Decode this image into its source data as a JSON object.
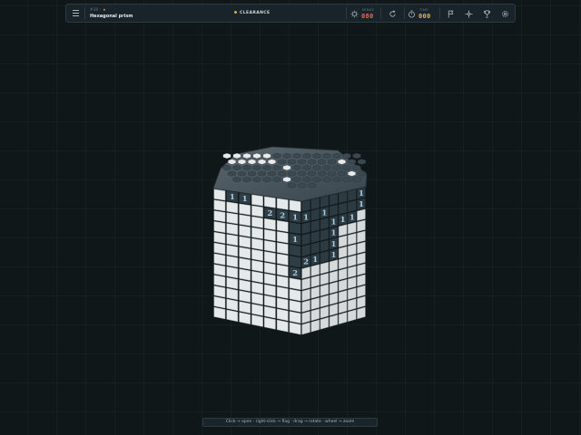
{
  "header": {
    "breadcrumb": "#30",
    "level_title": "Hexagonal prism",
    "mode_label": "CLEARANCE",
    "menu_icon": "hamburger-menu-icon",
    "accent_star_color": "#e0934a"
  },
  "stats": {
    "mines_label": "MINES",
    "mines_value": "080",
    "mines_color": "#e26a5a",
    "time_label": "TIME",
    "time_value": "000",
    "time_color": "#e3b54a"
  },
  "toolbar": {
    "buttons": [
      "restart-icon",
      "flag-icon",
      "crosshair-icon",
      "trophy-icon",
      "settings-icon"
    ]
  },
  "hint": "Click → open · right-click → flag · drag → rotate · wheel → zoom",
  "board": {
    "shape": "hexagonal prism",
    "grid_rows": 12,
    "face_left_columns": 7,
    "face_right_columns": 7,
    "cell_colors": {
      "closed": "#e6e9ea",
      "opened": "#2f3d45",
      "number": "#a9cde2"
    },
    "opened_cells": [
      {
        "face": "left",
        "row": 0,
        "col": 1,
        "number": "1"
      },
      {
        "face": "left",
        "row": 0,
        "col": 2,
        "number": "1"
      },
      {
        "face": "left",
        "row": 1,
        "col": 4,
        "number": "2"
      },
      {
        "face": "left",
        "row": 1,
        "col": 5,
        "number": "2"
      },
      {
        "face": "left",
        "row": 1,
        "col": 6,
        "number": "1"
      },
      {
        "face": "left",
        "row": 2,
        "col": 6,
        "number": ""
      },
      {
        "face": "left",
        "row": 3,
        "col": 6,
        "number": "1"
      },
      {
        "face": "left",
        "row": 4,
        "col": 6,
        "number": ""
      },
      {
        "face": "left",
        "row": 5,
        "col": 6,
        "number": ""
      },
      {
        "face": "left",
        "row": 6,
        "col": 6,
        "number": "2"
      },
      {
        "face": "right",
        "row": 0,
        "col": 0,
        "number": ""
      },
      {
        "face": "right",
        "row": 0,
        "col": 1,
        "number": ""
      },
      {
        "face": "right",
        "row": 0,
        "col": 2,
        "number": ""
      },
      {
        "face": "right",
        "row": 0,
        "col": 3,
        "number": ""
      },
      {
        "face": "right",
        "row": 0,
        "col": 4,
        "number": ""
      },
      {
        "face": "right",
        "row": 0,
        "col": 5,
        "number": ""
      },
      {
        "face": "right",
        "row": 0,
        "col": 6,
        "number": "1"
      },
      {
        "face": "right",
        "row": 1,
        "col": 0,
        "number": "1"
      },
      {
        "face": "right",
        "row": 1,
        "col": 1,
        "number": ""
      },
      {
        "face": "right",
        "row": 1,
        "col": 2,
        "number": "1"
      },
      {
        "face": "right",
        "row": 1,
        "col": 3,
        "number": ""
      },
      {
        "face": "right",
        "row": 1,
        "col": 4,
        "number": ""
      },
      {
        "face": "right",
        "row": 1,
        "col": 5,
        "number": ""
      },
      {
        "face": "right",
        "row": 1,
        "col": 6,
        "number": "1"
      },
      {
        "face": "right",
        "row": 2,
        "col": 0,
        "number": ""
      },
      {
        "face": "right",
        "row": 2,
        "col": 1,
        "number": ""
      },
      {
        "face": "right",
        "row": 2,
        "col": 2,
        "number": ""
      },
      {
        "face": "right",
        "row": 2,
        "col": 3,
        "number": "1"
      },
      {
        "face": "right",
        "row": 2,
        "col": 4,
        "number": "1"
      },
      {
        "face": "right",
        "row": 2,
        "col": 5,
        "number": "1"
      },
      {
        "face": "right",
        "row": 3,
        "col": 0,
        "number": ""
      },
      {
        "face": "right",
        "row": 3,
        "col": 1,
        "number": ""
      },
      {
        "face": "right",
        "row": 3,
        "col": 2,
        "number": ""
      },
      {
        "face": "right",
        "row": 3,
        "col": 3,
        "number": "1"
      },
      {
        "face": "right",
        "row": 4,
        "col": 0,
        "number": ""
      },
      {
        "face": "right",
        "row": 4,
        "col": 1,
        "number": ""
      },
      {
        "face": "right",
        "row": 4,
        "col": 2,
        "number": ""
      },
      {
        "face": "right",
        "row": 4,
        "col": 3,
        "number": "1"
      },
      {
        "face": "right",
        "row": 5,
        "col": 0,
        "number": "2"
      },
      {
        "face": "right",
        "row": 5,
        "col": 1,
        "number": "1"
      },
      {
        "face": "right",
        "row": 5,
        "col": 2,
        "number": ""
      },
      {
        "face": "right",
        "row": 5,
        "col": 3,
        "number": "1"
      }
    ]
  }
}
